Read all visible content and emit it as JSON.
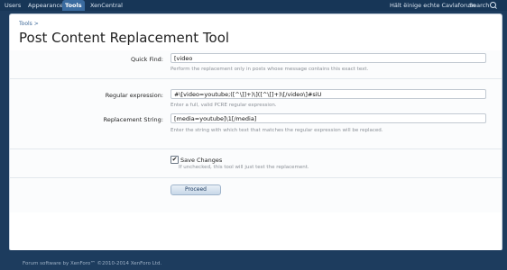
{
  "nav": {
    "tabs": [
      "Users",
      "Appearance",
      "Tools",
      "XenCentral"
    ],
    "active_tab": "Tools",
    "user_link": "Hält ëinige echte Cavlaforum",
    "search_label": "Search"
  },
  "breadcrumb": "Tools >",
  "page_title": "Post Content Replacement Tool",
  "form": {
    "quick_find": {
      "label": "Quick Find:",
      "value": "[video",
      "hint": "Perform the replacement only in posts whose message contains this exact text."
    },
    "regex": {
      "label": "Regular expression:",
      "value": "#\\[video=youtube;([^\\]]+)\\]([^\\[]+)\\[/video\\]#siU",
      "hint": "Enter a full, valid PCRE regular expression."
    },
    "replacement": {
      "label": "Replacement String:",
      "value": "[media=youtube]\\1[/media]",
      "hint": "Enter the string with which text that matches the regular expression will be replaced."
    },
    "save_changes": {
      "label": "Save Changes",
      "checked": true,
      "check_glyph": "✔",
      "hint": "If unchecked, this tool will just test the replacement."
    },
    "proceed_label": "Proceed"
  },
  "footer": "Forum software by XenForo™ ©2010-2014 XenForo Ltd.",
  "colors": {
    "background": "#1d3c5e",
    "active_tab": "#3a6b9f",
    "link": "#3c6797"
  }
}
